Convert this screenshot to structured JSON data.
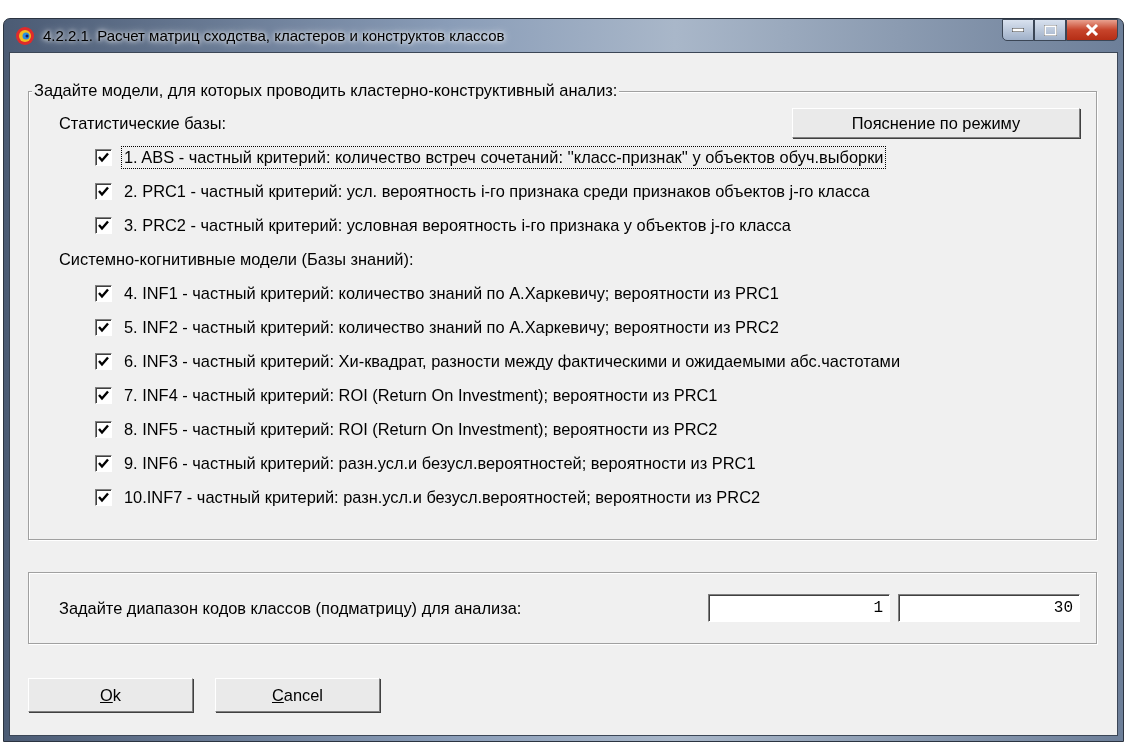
{
  "window": {
    "title": "4.2.2.1. Расчет матриц сходства, кластеров и конструктов классов"
  },
  "models_group": {
    "legend": "Задайте модели, для которых проводить кластерно-конструктивный анализ:",
    "help_button": "Пояснение по режиму",
    "sections": [
      {
        "label": "Статистические базы:",
        "items": [
          {
            "label": "1. ABS  - частный критерий: количество встреч сочетаний: ''класс-признак'' у объектов обуч.выборки",
            "checked": true,
            "focused": true
          },
          {
            "label": "2. PRC1 - частный критерий: усл. вероятность i-го признака среди признаков объектов j-го класса",
            "checked": true,
            "focused": false
          },
          {
            "label": "3. PRC2 - частный критерий: условная вероятность i-го признака у объектов j-го класса",
            "checked": true,
            "focused": false
          }
        ]
      },
      {
        "label": "Системно-когнитивные модели (Базы знаний):",
        "items": [
          {
            "label": "4. INF1 - частный критерий: количество знаний по А.Харкевичу; вероятности из PRC1",
            "checked": true,
            "focused": false
          },
          {
            "label": "5. INF2 - частный критерий: количество знаний по А.Харкевичу; вероятности из PRC2",
            "checked": true,
            "focused": false
          },
          {
            "label": "6. INF3 - частный критерий: Хи-квадрат, разности между фактическими и ожидаемыми абс.частотами",
            "checked": true,
            "focused": false
          },
          {
            "label": "7. INF4 - частный критерий: ROI (Return On Investment); вероятности из PRC1",
            "checked": true,
            "focused": false
          },
          {
            "label": "8. INF5 - частный критерий: ROI (Return On Investment); вероятности из PRC2",
            "checked": true,
            "focused": false
          },
          {
            "label": "9. INF6 - частный критерий: разн.усл.и безусл.вероятностей; вероятности из PRC1",
            "checked": true,
            "focused": false
          },
          {
            "label": "10.INF7 - частный критерий: разн.усл.и безусл.вероятностей; вероятности из PRC2",
            "checked": true,
            "focused": false
          }
        ]
      }
    ]
  },
  "range": {
    "label": "Задайте диапазон кодов классов (подматрицу) для анализа:",
    "from": "1",
    "to": "30"
  },
  "buttons": [
    "Ok",
    "Cancel"
  ]
}
